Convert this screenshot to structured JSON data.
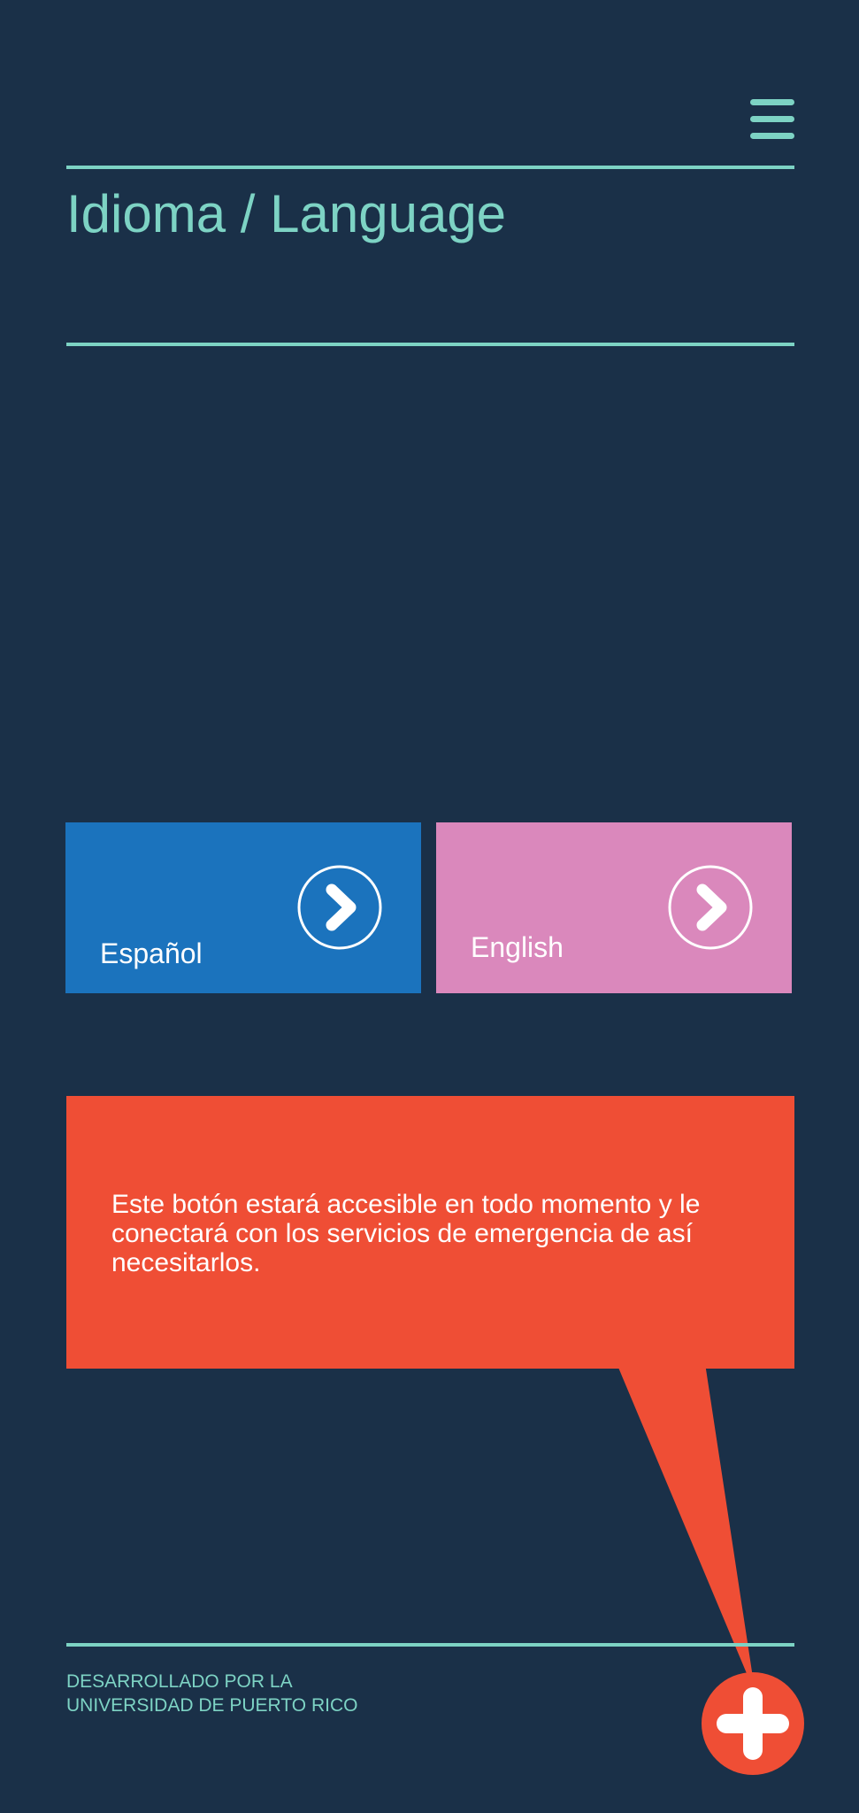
{
  "header": {
    "menu_icon": "hamburger-menu-icon",
    "title": "Idioma / Language"
  },
  "languages": [
    {
      "label": "Español",
      "icon": "chevron-right-circle-icon",
      "color": "#1b73bd"
    },
    {
      "label": "English",
      "icon": "chevron-right-circle-icon",
      "color": "#da88bc"
    }
  ],
  "callout": {
    "text": "Este botón estará accesible en todo momento y le conectará con los servicios de emergencia de así necesitarlos.",
    "color": "#ef4e35"
  },
  "footer": {
    "line1": "DESARROLLADO POR LA",
    "line2": "UNIVERSIDAD DE PUERTO RICO"
  },
  "emergency_button": {
    "icon": "plus-icon",
    "color": "#ef4e35"
  },
  "colors": {
    "background": "#1a3048",
    "accent": "#7dd3c4"
  }
}
